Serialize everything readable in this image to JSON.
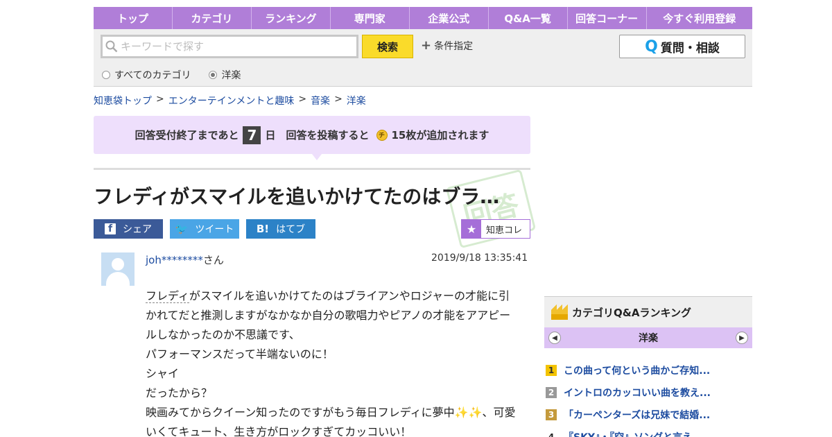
{
  "nav": [
    "トップ",
    "カテゴリ",
    "ランキング",
    "専門家",
    "企業公式",
    "Q&A一覧",
    "回答コーナー",
    "今すぐ利用登録"
  ],
  "search": {
    "placeholder": "キーワードで探す",
    "button": "検索",
    "condition": "条件指定",
    "ask_button": "質問・相談",
    "ask_icon_letter": "Q",
    "radio_all": "すべてのカテゴリ",
    "radio_category": "洋楽"
  },
  "breadcrumb": [
    "知恵袋トップ",
    "エンターテインメントと趣味",
    "音楽",
    "洋楽"
  ],
  "banner": {
    "text1": "回答受付終了まであと",
    "days": "7",
    "text2": "日　回答を投稿すると",
    "coin": "チ",
    "text3": "15枚が追加されます"
  },
  "question": {
    "title": "フレディがスマイルを追いかけてたのはブラ…",
    "user": "joh********",
    "user_suffix": "さん",
    "date": "2019/9/18  13:35:41",
    "lines": [
      "がスマイルを追いかけてたのはブライアンやロジャーの才能に引",
      "かれてだと推測しますがなかなか自分の歌唱力やピアノの才能をアアピー",
      "ルしなかったのか不思議です、",
      "パフォーマンスだって半端ないのに！",
      "シャイ",
      "だったから？",
      "映画みてからクイーン知ったのですがもう毎日フレディに夢中✨✨、可愛",
      "いくてキュート、生き方がロックすぎてカッコいい！"
    ],
    "first_link": "フレディ"
  },
  "share": {
    "facebook": "シェア",
    "facebook_icon": "f",
    "twitter": "ツイート",
    "twitter_icon": "🐦",
    "hatena": "はてブ",
    "hatena_icon": "B!",
    "chiekore": "知恵コレ"
  },
  "stamp": "回答",
  "ranking": {
    "title": "カテゴリQ&Aランキング",
    "category": "洋楽",
    "items": [
      {
        "num": "1",
        "text": "この曲って何という曲かご存知..."
      },
      {
        "num": "2",
        "text": "イントロのカッコいい曲を教え..."
      },
      {
        "num": "3",
        "text": "「カーペンターズは兄妹で結婚..."
      },
      {
        "num": "4",
        "text": "『SKY』・『空』ソングと言え..."
      }
    ]
  }
}
